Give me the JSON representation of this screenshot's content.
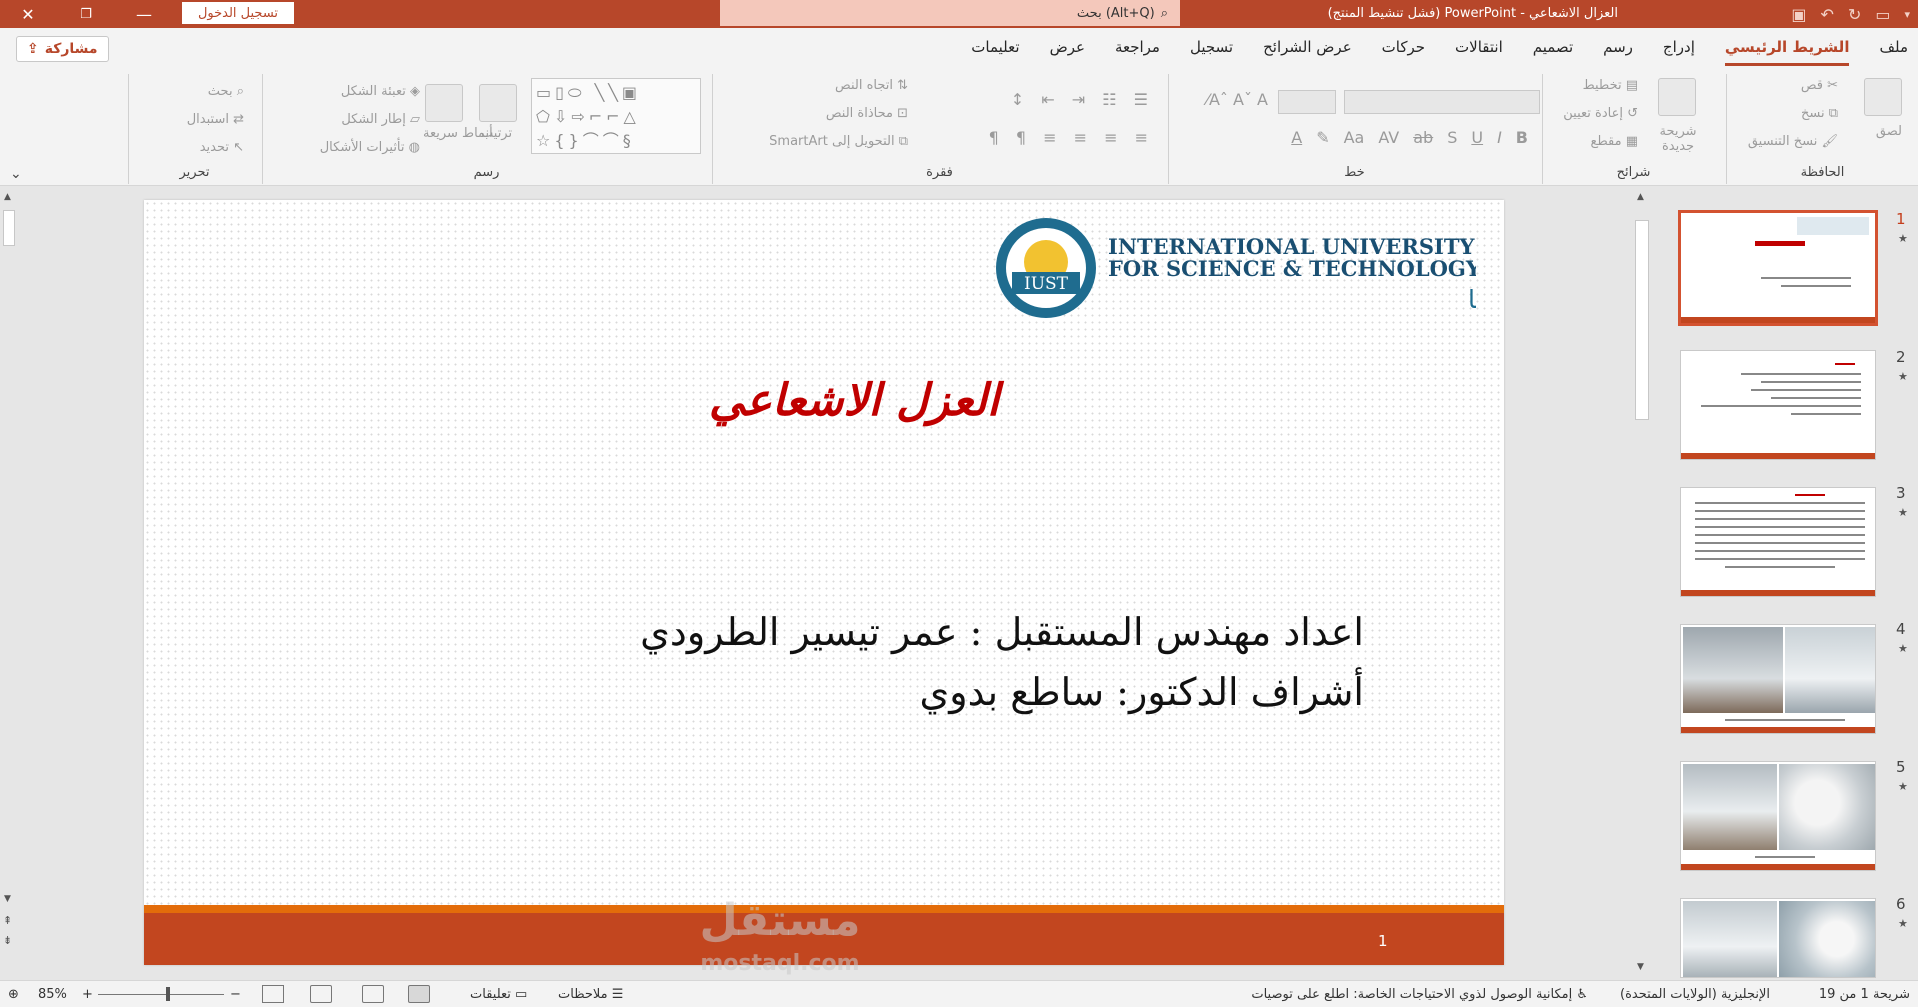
{
  "titlebar": {
    "signin_label": "تسجيل الدخول",
    "search_placeholder": "بحث (Alt+Q)",
    "window_title": "العزال الاشعاعي - PowerPoint (فشل تنشيط المنتج)"
  },
  "tabs": [
    {
      "label": "ملف",
      "active": false
    },
    {
      "label": "الشريط الرئيسي",
      "active": true
    },
    {
      "label": "إدراج",
      "active": false
    },
    {
      "label": "رسم",
      "active": false
    },
    {
      "label": "تصميم",
      "active": false
    },
    {
      "label": "انتقالات",
      "active": false
    },
    {
      "label": "حركات",
      "active": false
    },
    {
      "label": "عرض الشرائح",
      "active": false
    },
    {
      "label": "تسجيل",
      "active": false
    },
    {
      "label": "مراجعة",
      "active": false
    },
    {
      "label": "عرض",
      "active": false
    },
    {
      "label": "تعليمات",
      "active": false
    }
  ],
  "share_label": "مشاركة",
  "ribbon": {
    "clipboard": {
      "group": "الحافظة",
      "paste": "لصق",
      "cut": "قص",
      "copy": "نسخ",
      "format_painter": "نسخ التنسيق"
    },
    "slides": {
      "group": "شرائح",
      "new_slide": "شريحة جديدة",
      "layout": "تخطيط",
      "reset": "إعادة تعيين",
      "section": "مقطع"
    },
    "font": {
      "group": "خط"
    },
    "paragraph": {
      "group": "فقرة",
      "text_direction": "اتجاه النص",
      "align_text": "محاذاة النص",
      "smartart": "التحويل إلى SmartArt"
    },
    "drawing": {
      "group": "رسم",
      "arrange": "ترتيب",
      "quick_styles": "أنماط سريعة",
      "shape_fill": "تعبئة الشكل",
      "shape_outline": "إطار الشكل",
      "shape_effects": "تأثيرات الأشكال"
    },
    "editing": {
      "group": "تحرير",
      "find": "بحث",
      "replace": "استبدال",
      "select": "تحديد"
    }
  },
  "slide": {
    "logo_en_1": "INTERNATIONAL UNIVERSITY",
    "logo_en_2": "FOR SCIENCE & TECHNOLOGY",
    "logo_ar": "الجامعة الدولية الخاصة للعلوم والتكنولوجيا",
    "logo_badge": "IUST",
    "title": "العزل الاشعاعي",
    "line1": "اعداد مهندس المستقبل : عمر تيسير الطرودي",
    "line2": "أشراف الدكتور: ساطع بدوي",
    "page_number": "1"
  },
  "watermark": {
    "line1": "مستقل",
    "line2": "mostaql.com"
  },
  "thumbnails": [
    {
      "number": "1",
      "selected": true
    },
    {
      "number": "2",
      "selected": false
    },
    {
      "number": "3",
      "selected": false
    },
    {
      "number": "4",
      "selected": false
    },
    {
      "number": "5",
      "selected": false
    },
    {
      "number": "6",
      "selected": false
    }
  ],
  "status": {
    "slide_counter": "شريحة 1 من 19",
    "language": "الإنجليزية (الولايات المتحدة)",
    "accessibility": "إمكانية الوصول لذوي الاحتياجات الخاصة: اطلع على توصيات",
    "notes": "ملاحظات",
    "comments": "تعليقات",
    "zoom": "85%"
  },
  "colors": {
    "accent": "#b7472a",
    "slide_bar": "#c2461f",
    "slide_title": "#c00000"
  }
}
